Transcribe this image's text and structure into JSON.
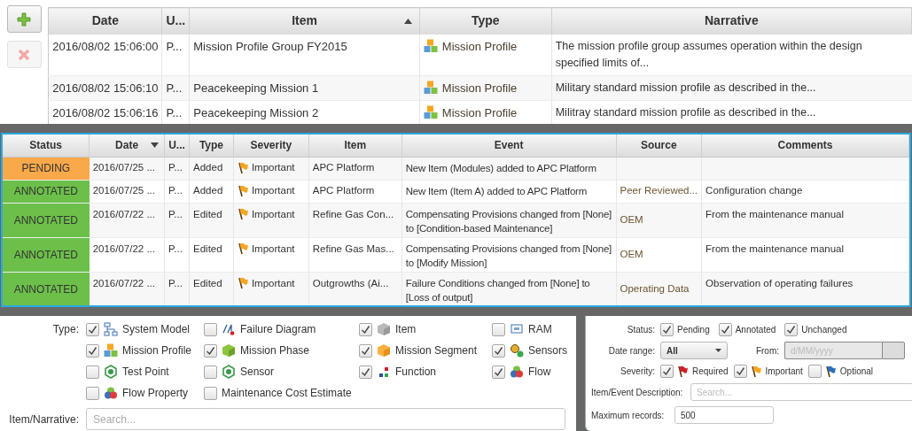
{
  "toolbar": {
    "buttons": [
      {
        "kind": "add",
        "disabled": false
      },
      {
        "kind": "delete",
        "disabled": true
      }
    ]
  },
  "profiles_table": {
    "sort_descending": false,
    "columns": [
      {
        "label": "Date",
        "sorted": false
      },
      {
        "label": "U...",
        "sorted": false
      },
      {
        "label": "Item",
        "sorted": true
      },
      {
        "label": "Type",
        "sorted": false
      },
      {
        "label": "Narrative",
        "sorted": false
      }
    ],
    "rows": [
      {
        "date": "2016/08/02 15:06:00",
        "user": "P...",
        "item": "Mission Profile Group FY2015",
        "type": "Mission Profile",
        "narrative": "The mission profile group assumes operation within the design specified limits of..."
      },
      {
        "date": "2016/08/02 15:06:10",
        "user": "P...",
        "item": "Peacekeeping Mission 1",
        "type": "Mission Profile",
        "narrative": "Military standard mission profile as described in the..."
      },
      {
        "date": "2016/08/02 15:06:16",
        "user": "P...",
        "item": "Peacekeeping Mission 2",
        "type": "Mission Profile",
        "narrative": "Militray standard mission profile as described in the..."
      }
    ]
  },
  "events_table": {
    "sort_descending": true,
    "columns": [
      {
        "label": "Status",
        "sorted": false
      },
      {
        "label": "Date",
        "sorted": true
      },
      {
        "label": "U...",
        "sorted": false
      },
      {
        "label": "Type",
        "sorted": false
      },
      {
        "label": "Severity",
        "sorted": false
      },
      {
        "label": "Item",
        "sorted": false
      },
      {
        "label": "Event",
        "sorted": false
      },
      {
        "label": "Source",
        "sorted": false
      },
      {
        "label": "Comments",
        "sorted": false
      }
    ],
    "rows": [
      {
        "status": "PENDING",
        "color": "#f9a84a",
        "date": "2016/07/25 ...",
        "user": "P...",
        "type": "Added",
        "severity": "Important",
        "item": "APC Platform",
        "event": "New Item (Modules) added to APC Platform"
      },
      {
        "status": "ANNOTATED",
        "color": "#6cc04a",
        "date": "2016/07/25 ...",
        "user": "P...",
        "type": "Added",
        "severity": "Important",
        "item": "APC Platform",
        "event": "New Item (Item A) added to APC Platform",
        "source": "Peer Reviewed...",
        "comments": "Configuration change"
      },
      {
        "status": "ANNOTATED",
        "color": "#6cc04a",
        "date": "2016/07/22 ...",
        "user": "P...",
        "type": "Edited",
        "severity": "Important",
        "item": "Refine Gas Con...",
        "event": "Compensating Provisions changed from [None] to [Condition-based Maintenance]",
        "source": "OEM",
        "comments": "From the maintenance manual"
      },
      {
        "status": "ANNOTATED",
        "color": "#6cc04a",
        "date": "2016/07/22 ...",
        "user": "P...",
        "type": "Edited",
        "severity": "Important",
        "item": "Refine Gas Mas...",
        "event": "Compensating Provisions changed from [None] to [Modify Mission]",
        "source": "OEM",
        "comments": "From the maintenance manual"
      },
      {
        "status": "ANNOTATED",
        "color": "#6cc04a",
        "date": "2016/07/22 ...",
        "user": "P...",
        "type": "Edited",
        "severity": "Important",
        "item": "Outgrowths (Ai...",
        "event": "Failure Conditions changed from [None] to [Loss of output]",
        "source": "Operating Data",
        "comments": "Observation of operating failures"
      }
    ]
  },
  "type_filter": {
    "label": "Type:",
    "options": [
      {
        "label": "System Model",
        "checked": true,
        "kind": "hierarchy"
      },
      {
        "label": "Failure Diagram",
        "checked": false,
        "kind": "failure"
      },
      {
        "label": "Item",
        "checked": true,
        "kind": "grey-cube"
      },
      {
        "label": "RAM",
        "checked": false,
        "kind": "ram"
      },
      {
        "label": "Mission Profile",
        "checked": true,
        "kind": "cubes"
      },
      {
        "label": "Mission Phase",
        "checked": true,
        "kind": "green-cube"
      },
      {
        "label": "Mission Segment",
        "checked": true,
        "kind": "orange-cube"
      },
      {
        "label": "Sensors",
        "checked": true,
        "kind": "sensors"
      },
      {
        "label": "Test Point",
        "checked": false,
        "kind": "ring"
      },
      {
        "label": "Sensor",
        "checked": false,
        "kind": "ring"
      },
      {
        "label": "Function",
        "checked": true,
        "kind": "squares"
      },
      {
        "label": "Flow",
        "checked": true,
        "kind": "circles"
      },
      {
        "label": "Flow Property",
        "checked": false,
        "kind": "circles"
      },
      {
        "label": "Maintenance Cost Estimate",
        "checked": false,
        "kind": "none"
      }
    ]
  },
  "item_narrative": {
    "label": "Item/Narrative:",
    "placeholder": "Search..."
  },
  "event_filter": {
    "status": {
      "label": "Status:",
      "options": [
        {
          "label": "Pending",
          "checked": true
        },
        {
          "label": "Annotated",
          "checked": true
        },
        {
          "label": "Unchanged",
          "checked": true
        }
      ]
    },
    "date_range": {
      "label": "Date range:",
      "value": "All"
    },
    "from": {
      "label": "From:",
      "placeholder": "d/MM/yyyy",
      "disabled": true
    },
    "severity": {
      "label": "Severity:",
      "options": [
        {
          "label": "Required",
          "checked": true,
          "color": "#d0202a"
        },
        {
          "label": "Important",
          "checked": true,
          "color": "#f5a623"
        },
        {
          "label": "Optional",
          "checked": false,
          "color": "#2a6fb8"
        }
      ]
    },
    "description": {
      "label": "Item/Event Description:",
      "placeholder": "Search..."
    },
    "max_records": {
      "label": "Maximum records:",
      "value": "500"
    }
  }
}
